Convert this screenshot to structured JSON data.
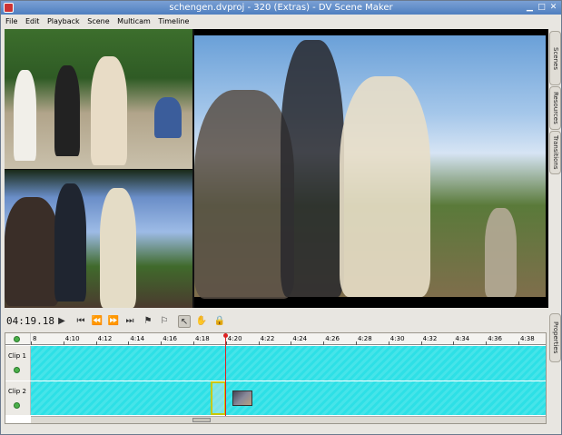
{
  "window": {
    "title": "schengen.dvproj - 320 (Extras) - DV Scene Maker"
  },
  "menu": [
    "File",
    "Edit",
    "Playback",
    "Scene",
    "Multicam",
    "Timeline"
  ],
  "side_tabs": [
    "Scenes",
    "Resources",
    "Transitions"
  ],
  "properties_tab": "Properties",
  "transport": {
    "timecode": "04:19.18",
    "buttons": [
      "play-icon",
      "go-start-icon",
      "rewind-icon",
      "fast-forward-icon",
      "go-end-icon",
      "mark-in-icon",
      "mark-out-icon",
      "pointer-icon",
      "hand-icon",
      "lock-icon"
    ]
  },
  "timeline": {
    "ticks": [
      "8",
      "4:10",
      "4:12",
      "4:14",
      "4:16",
      "4:18",
      "4:20",
      "4:22",
      "4:24",
      "4:26",
      "4:28",
      "4:30",
      "4:32",
      "4:34",
      "4:36",
      "4:38"
    ],
    "tracks": [
      {
        "name": "Clip 1"
      },
      {
        "name": "Clip 2"
      }
    ],
    "playhead_fraction": 0.378,
    "track_color": "#2de0e6"
  }
}
